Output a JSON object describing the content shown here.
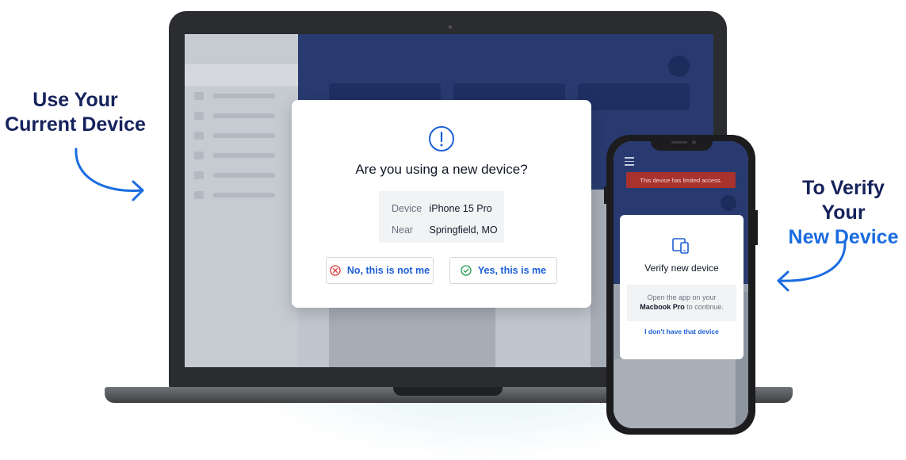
{
  "callouts": {
    "left": [
      "Use Your",
      "Current Device"
    ],
    "right": [
      "To Verify Your",
      "New Device"
    ]
  },
  "dialog": {
    "title": "Are you using a new device?",
    "device_label": "Device",
    "device_value": "iPhone 15 Pro",
    "near_label": "Near",
    "near_value": "Springfield, MO",
    "deny_button": "No, this is not me",
    "confirm_button": "Yes, this is me",
    "icons": {
      "alert": "exclamation-circle-icon",
      "deny": "x-circle-icon",
      "confirm": "check-circle-icon"
    }
  },
  "phone": {
    "warning": "This device has limited access.",
    "card_title": "Verify new device",
    "message_pre": "Open the app on your",
    "message_device": "Macbook Pro",
    "message_post": "to continue.",
    "link": "I don't have that device",
    "icons": {
      "menu": "hamburger-menu-icon",
      "devices": "devices-icon"
    }
  },
  "colors": {
    "navy_text": "#16225c",
    "accent_blue": "#1a6ce0",
    "button_text_blue": "#1d5fd6",
    "deny_red": "#d93636",
    "confirm_green": "#1f9a4a",
    "warning_red": "#a8322d",
    "app_header_navy": "#283a70"
  }
}
